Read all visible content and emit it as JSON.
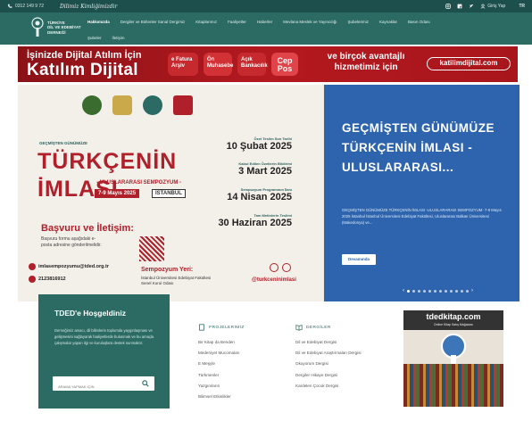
{
  "topbar": {
    "phone": "0312 149 9 72",
    "script_text": "Dilimiz Kimliğimizdir",
    "login": "Giriş Yap",
    "lang": "TR"
  },
  "nav": {
    "logo_lines": [
      "TÜRKİYE",
      "DİL VE EDEBİYAT",
      "DERNEĞİ"
    ],
    "items": [
      "Hakkımızda",
      "Dergiler ve Bültenler Sanal Dergimiz",
      "Kitaplarımız",
      "Faaliyetler",
      "Haberler",
      "Mevlana Meslek ve Yayıncılığı",
      "Şubelerimiz",
      "Kaynaklar",
      "Basın Odası"
    ],
    "sub_items": [
      "Şubeler",
      "İletişim"
    ]
  },
  "banner": {
    "line1": "İşinizde Dijital Atılım İçin",
    "line2": "Katılım Dijital",
    "pills": [
      "e Fatura Arşiv",
      "Ön Muhasebe",
      "Açık Bankacılık",
      "Cep Pos"
    ],
    "tagline": "ve birçok avantajlı hizmetimiz için",
    "url": "katilimdijital.com"
  },
  "poster": {
    "tag": "GEÇMİŞTEN GÜNÜMÜZE",
    "title1": "TÜRKÇENİN",
    "title2": "İMLASI",
    "subtitle": "- ULUSLARARASI SEMPOZYUM -",
    "dates": "7-9 Mayıs 2025",
    "city": "İSTANBUL",
    "deadlines": [
      {
        "label": "Özet Teslim Son Tarihi",
        "value": "10 Şubat 2025"
      },
      {
        "label": "Kabul Edilen Özetlerin Bildirimi",
        "value": "3 Mart 2025"
      },
      {
        "label": "Sempozyum Programının İlanı",
        "value": "14 Nisan 2025"
      },
      {
        "label": "Tam Metinlerin Teslimi",
        "value": "30 Haziran 2025"
      }
    ],
    "apply_title": "Başvuru ve İletişim:",
    "apply_text": "Başvuru formu aşağıdaki e-posta adresine gönderilmelidir.",
    "email": "imlasempozyumu@tded.org.tr",
    "phone": "2123816912",
    "venue_title": "Sempozyum Yeri:",
    "venue_text": "İstanbul Üniversitesi Edebiyat Fakültesi Senel Kurul Odası",
    "handle": "@turkceninimlasi"
  },
  "hero": {
    "title": "GEÇMİŞTEN GÜNÜMÜZE TÜRKÇENİN İMLASI - ULUSLARARASI...",
    "desc": "GEÇMİŞTEN GÜNÜMÜZE TÜRKÇENİN İMLASI -ULUSLARARASI SEMPOZYUM- 7-9 Mayıs 2025 İstanbul İstanbul Üniversitesi Edebiyat Fakültesi, Uluslararası Balkan Üniversitesi (Makedonya) ve...",
    "more": "Devamında",
    "slides": 12,
    "active_slide": 1
  },
  "welcome": {
    "title": "TDED'e Hoşgeldiniz",
    "text": "Derneğimiz amacı, dil bilimlerin toplumda yaygınlaşması ve gelişmesini sağlayarak faaliyetlerde bulunmak ve bu amaçla çalışmalar yapan ilgi ve kuruluşlara destek sunmaktır.",
    "search_placeholder": "ARAMA YAPMAK İÇİN"
  },
  "projects": {
    "heading": "PROJELERİMİZ",
    "items": [
      "Bir Kitap da Benden",
      "Medeniyet Mucomaları",
      "E Meşyle",
      "Türkmenler",
      "Yazgınıların",
      "Bilimsel Etkinlikler"
    ]
  },
  "journals": {
    "heading": "DERGİLER",
    "items": [
      "Dil ve Edebiyat Dergisi",
      "Dil ve Edebiyat Araştırmaları Dergisi",
      "Okuyorum Dergisi",
      "Dergiler Hikaye Dergisi",
      "Kardelen Çocuk Dergisi"
    ]
  },
  "sidead": {
    "title": "tdedkitap.com",
    "subtitle": "Online Kitap Satış Mağazası"
  },
  "colors": {
    "topbar": "#1d4f4c",
    "nav": "#2b6b63",
    "banner": "#b3191f",
    "hero": "#2d64ad",
    "poster_accent": "#b0202a"
  }
}
